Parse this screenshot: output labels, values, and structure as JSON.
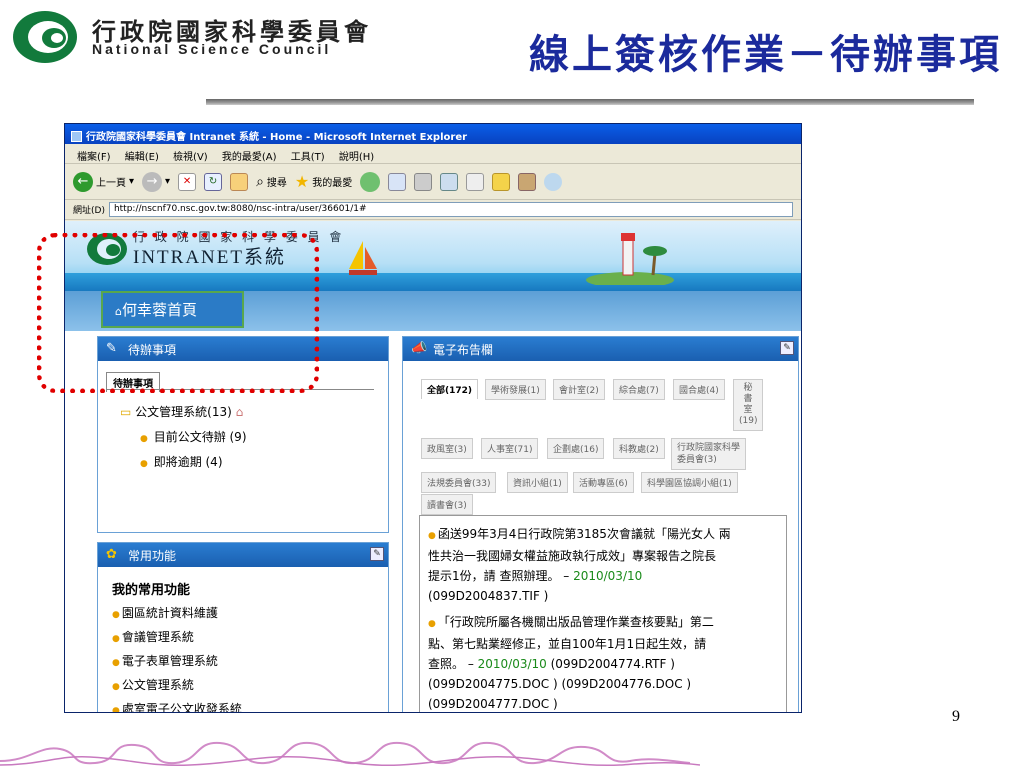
{
  "header": {
    "org_cn": "行政院國家科學委員會",
    "org_en": "National Science Council",
    "slide_title": "線上簽核作業－待辦事項"
  },
  "browser": {
    "title_bar": "行政院國家科學委員會 Intranet 系統 - Home - Microsoft Internet Explorer",
    "menu": [
      "檔案(F)",
      "編輯(E)",
      "檢視(V)",
      "我的最愛(A)",
      "工具(T)",
      "說明(H)"
    ],
    "toolbar": {
      "back_label": "上一頁",
      "search_label": "搜尋",
      "favorites_label": "我的最愛"
    },
    "address_label": "網址(D)",
    "address_value": "http://nscnf70.nsc.gov.tw:8080/nsc-intra/user/36601/1#"
  },
  "intranet": {
    "banner_cn": "行 政 院 國 家 科 學 委 員 會",
    "banner_en": "INTRANET系統",
    "home_tab": "何幸蓉首頁"
  },
  "todo_panel": {
    "title": "待辦事項",
    "tab": "待辦事項",
    "items": [
      {
        "label": "公文管理系統(13)"
      },
      {
        "label": "目前公文待辦 (9)"
      },
      {
        "label": "即將逾期 (4)"
      }
    ]
  },
  "fav_panel": {
    "title": "常用功能",
    "section": "我的常用功能",
    "items": [
      "園區統計資料維護",
      "會議管理系統",
      "電子表單管理系統",
      "公文管理系統",
      "處室電子公文收發系統"
    ]
  },
  "board_panel": {
    "title": "電子布告欄",
    "tabs_row1": [
      "全部(172)",
      "學術發展(1)",
      "會計室(2)",
      "綜合處(7)",
      "國合處(4)"
    ],
    "secretary_tab": [
      "秘",
      "書",
      "室",
      "(19)"
    ],
    "tabs_row2": [
      "政風室(3)",
      "人事室(71)",
      "企劃處(16)",
      "科教處(2)"
    ],
    "tab_row2_last": [
      "行政院國家科學",
      "委員會(3)"
    ],
    "tabs_row3": [
      "法規委員會(33)",
      "資訊小組(1)",
      "活動專區(6)",
      "科學園區協調小組(1)"
    ],
    "tabs_row4": [
      "讀書會(3)"
    ],
    "news": [
      {
        "lines": [
          "函送99年3月4日行政院第3185次會議就「陽光女人 兩",
          "性共治一我國婦女權益施政執行成效」專案報告之院長",
          "提示1份，請 查照辦理。 – "
        ],
        "date": "2010/03/10",
        "tail": "(099D2004837.TIF )"
      },
      {
        "lines": [
          "「行政院所屬各機關出版品管理作業查核要點」第二",
          "點、第七點業經修正，並自100年1月1日起生效，請",
          "查照。 – "
        ],
        "date": "2010/03/10",
        "tail_same_line": " (099D2004774.RTF )",
        "tail_lines": [
          "(099D2004775.DOC ) (099D2004776.DOC )",
          "(099D2004777.DOC )"
        ]
      }
    ]
  },
  "page_number": "9",
  "colors": {
    "title_blue": "#1b2a9c",
    "panel_blue": "#1a5fb0",
    "dotted_red": "#e00000",
    "date_green": "#1a8a1a"
  }
}
